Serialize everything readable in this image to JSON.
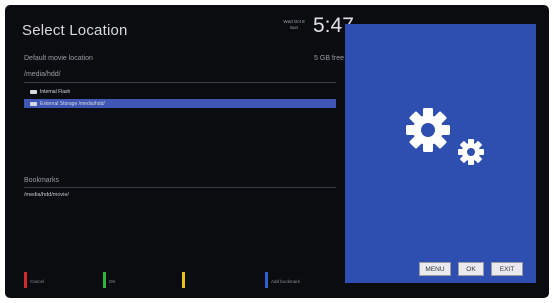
{
  "header": {
    "title": "Select Location",
    "date": "Wed Oct 8 Sun",
    "time": "5:47"
  },
  "location": {
    "default_label": "Default movie location",
    "free_space": "5 GB free",
    "current_path": "/media/hdd/"
  },
  "storage_items": [
    {
      "label": "Internal Flash",
      "selected": false
    },
    {
      "label": "External Storage /media/hdd/",
      "selected": true
    }
  ],
  "bookmarks": {
    "header": "Bookmarks",
    "items": [
      "/media/hdd/movie/"
    ]
  },
  "buttons": {
    "menu": "MENU",
    "ok": "OK",
    "exit": "EXIT"
  },
  "color_keys": [
    {
      "color": "#d22a2a",
      "label": "Cancel"
    },
    {
      "color": "#2fb53a",
      "label": "OK"
    },
    {
      "color": "#e8c21a",
      "label": ""
    },
    {
      "color": "#2f5fd0",
      "label": "Add bookmark"
    }
  ],
  "colors": {
    "background": "#0b0c10",
    "selection": "#3f56b4",
    "preview_panel": "#2f4fb0"
  },
  "icons": {
    "preview": "settings-gears-icon",
    "folder": "folder-icon"
  }
}
